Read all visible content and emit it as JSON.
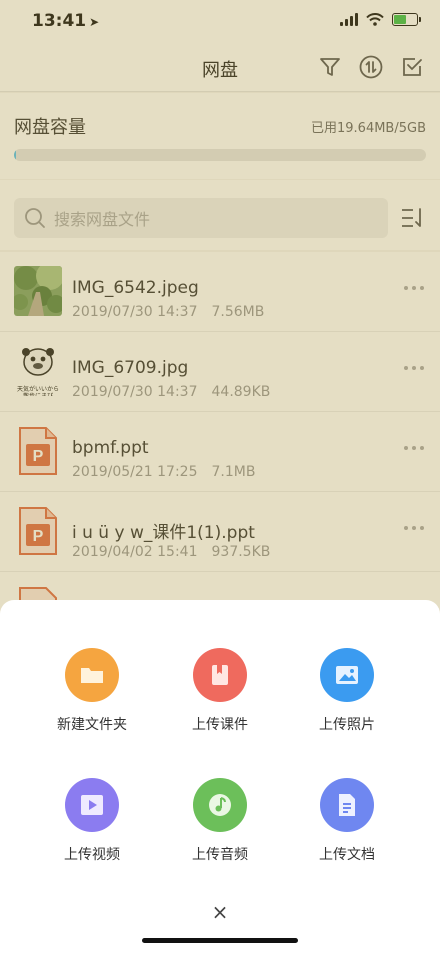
{
  "status_bar": {
    "time": "13:41",
    "location_arrow": "location-arrow-icon"
  },
  "nav": {
    "title": "网盘",
    "icons": [
      "filter-icon",
      "transfer-icon",
      "select-icon"
    ]
  },
  "quota": {
    "title": "网盘容量",
    "used_text": "已用19.64MB/5GB",
    "used_fraction": 0.004
  },
  "search": {
    "placeholder": "搜索网盘文件",
    "sort_icon": "sort-icon"
  },
  "files": [
    {
      "name": "IMG_6542.jpeg",
      "date": "2019/07/30 14:37",
      "size": "7.56MB",
      "thumb": "photo"
    },
    {
      "name": "IMG_6709.jpg",
      "date": "2019/07/30 14:37",
      "size": "44.89KB",
      "thumb": "sticker",
      "thumb_caption": "天気がいいから 散歩にまぴ"
    },
    {
      "name": "bpmf.ppt",
      "date": "2019/05/21 17:25",
      "size": "7.1MB",
      "thumb": "ppt"
    },
    {
      "name": "i u ü y w_课件1(1).ppt",
      "date": "2019/04/02 15:41",
      "size": "937.5KB",
      "thumb": "ppt"
    }
  ],
  "ppt_letter": "P",
  "sheet": {
    "actions": [
      {
        "label": "新建文件夹",
        "icon": "folder-icon",
        "color": "#f5a540"
      },
      {
        "label": "上传课件",
        "icon": "courseware-icon",
        "color": "#ef6a5e"
      },
      {
        "label": "上传照片",
        "icon": "photo-icon",
        "color": "#3b9bf0"
      },
      {
        "label": "上传视频",
        "icon": "video-icon",
        "color": "#8b7cf0"
      },
      {
        "label": "上传音频",
        "icon": "audio-icon",
        "color": "#6cbf5a"
      },
      {
        "label": "上传文档",
        "icon": "document-icon",
        "color": "#6f87f0"
      }
    ],
    "close": "×"
  },
  "colors": {
    "overlay": "#a8903c",
    "quota_fill": "#52c2f0",
    "ppt": "#e06b47"
  }
}
